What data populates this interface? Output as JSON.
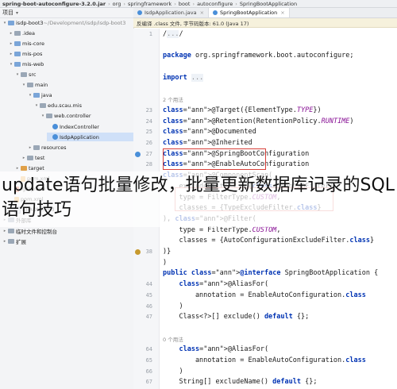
{
  "breadcrumb": [
    "spring-boot-autoconfigure-3.2.0.jar",
    "org",
    "springframework",
    "boot",
    "autoconfigure",
    "SpringBootApplication"
  ],
  "project": {
    "header": "项目",
    "tree": [
      {
        "label": "isdp-boot3",
        "suffix": "~/Development/isdp/isdp-boot3",
        "kind": "folder-blue",
        "open": true
      },
      {
        "label": ".idea",
        "kind": "folder",
        "open": false
      },
      {
        "label": "mis-core",
        "kind": "folder-blue",
        "open": false
      },
      {
        "label": "mis-pos",
        "kind": "folder-blue",
        "open": false
      },
      {
        "label": "mis-web",
        "kind": "folder-blue",
        "open": true
      },
      {
        "label": "src",
        "kind": "folder",
        "open": true
      },
      {
        "label": "main",
        "kind": "folder",
        "open": true
      },
      {
        "label": "java",
        "kind": "folder-blue",
        "open": true
      },
      {
        "label": "edu.scau.mis",
        "kind": "folder",
        "open": true
      },
      {
        "label": "web.controller",
        "kind": "folder",
        "open": true
      },
      {
        "label": "IndexController",
        "kind": "java",
        "open": null
      },
      {
        "label": "IsdpApplication",
        "kind": "java",
        "open": null,
        "selected": true
      },
      {
        "label": "resources",
        "kind": "folder",
        "open": false
      },
      {
        "label": "test",
        "kind": "folder",
        "open": false
      },
      {
        "label": "target",
        "kind": "folder-orange",
        "open": false
      },
      {
        "label": "pom.xml",
        "kind": "xml",
        "open": null
      },
      {
        "label": ".gitignore",
        "kind": "git",
        "open": null
      },
      {
        "label": "pom.xml",
        "kind": "xml",
        "open": null
      },
      {
        "label": "README.md",
        "kind": "file",
        "open": null
      },
      {
        "label": "外部库",
        "kind": "folder",
        "open": false
      },
      {
        "label": "临时文件和控制台",
        "kind": "folder",
        "open": false
      },
      {
        "label": "扩展",
        "kind": "folder",
        "open": false
      }
    ]
  },
  "editor": {
    "tabs": [
      {
        "label": "IsdpApplication.java",
        "active": false
      },
      {
        "label": "SpringBootApplication",
        "active": true
      }
    ],
    "infobar": "反编译 .class 文件, 字节码版本: 61.0 (Java 17)",
    "line_numbers": [
      "1",
      "",
      "",
      "",
      "",
      "",
      "",
      "23",
      "24",
      "25",
      "26",
      "27",
      "28",
      "",
      "",
      "",
      "",
      "",
      "",
      "",
      "38",
      "",
      "",
      "",
      "",
      "",
      "",
      "",
      "",
      "",
      "",
      "",
      "",
      ""
    ],
    "lines": [
      {
        "type": "code",
        "text": "/.../"
      },
      {
        "type": "code",
        "text": ""
      },
      {
        "type": "code",
        "text": "package org.springframework.boot.autoconfigure;"
      },
      {
        "type": "code",
        "text": ""
      },
      {
        "type": "code",
        "text": "import ..."
      },
      {
        "type": "code",
        "text": ""
      },
      {
        "type": "hint",
        "text": "2 个用法"
      },
      {
        "type": "code",
        "text": "@Target({ElementType.TYPE})"
      },
      {
        "type": "code",
        "text": "@Retention(RetentionPolicy.RUNTIME)"
      },
      {
        "type": "code",
        "text": "@Documented"
      },
      {
        "type": "code",
        "text": "@Inherited"
      },
      {
        "type": "code",
        "text": "@SpringBootConfiguration"
      },
      {
        "type": "code",
        "text": "@EnableAutoConfiguration"
      },
      {
        "type": "code",
        "text": "@ComponentScan("
      },
      {
        "type": "code",
        "text": "    excludeFilters = {@Filter("
      },
      {
        "type": "code",
        "text": "    type = FilterType.CUSTOM,"
      },
      {
        "type": "code",
        "text": "    classes = {TypeExcludeFilter.class}"
      },
      {
        "type": "code",
        "text": "), @Filter("
      },
      {
        "type": "code",
        "text": "    type = FilterType.CUSTOM,"
      },
      {
        "type": "code",
        "text": "    classes = {AutoConfigurationExcludeFilter.class}"
      },
      {
        "type": "code",
        "text": ")}"
      },
      {
        "type": "code",
        "text": ")"
      },
      {
        "type": "code",
        "text": "public @interface SpringBootApplication {"
      },
      {
        "type": "code",
        "text": "    @AliasFor("
      },
      {
        "type": "code",
        "text": "        annotation = EnableAutoConfiguration.class"
      },
      {
        "type": "code",
        "text": "    )"
      },
      {
        "type": "code",
        "text": "    Class<?>[] exclude() default {};"
      },
      {
        "type": "code",
        "text": ""
      },
      {
        "type": "hint",
        "text": "0 个用法"
      },
      {
        "type": "code",
        "text": "    @AliasFor("
      },
      {
        "type": "code",
        "text": "        annotation = EnableAutoConfiguration.class"
      },
      {
        "type": "code",
        "text": "    )"
      },
      {
        "type": "code",
        "text": "    String[] excludeName() default {};"
      }
    ],
    "gutter_extra": [
      "44",
      "45",
      "46",
      "47",
      "64",
      "65",
      "66",
      "67"
    ]
  },
  "overlay": {
    "text": "update语句批量修改，批量更新数据库记录的SQL语句技巧"
  },
  "colors": {
    "keyword": "#0033b3",
    "annotation": "#9e880d",
    "highlight_box": "#d9413a"
  }
}
